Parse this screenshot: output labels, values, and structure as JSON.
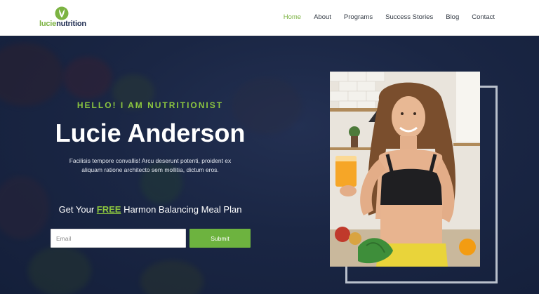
{
  "brand": {
    "name_part1": "lucie",
    "name_part2": "nutrition",
    "accent": "#7cb342",
    "navy": "#1d2b4f"
  },
  "nav": {
    "items": [
      {
        "label": "Home",
        "active": true
      },
      {
        "label": "About"
      },
      {
        "label": "Programs"
      },
      {
        "label": "Success Stories"
      },
      {
        "label": "Blog"
      },
      {
        "label": "Contact"
      }
    ]
  },
  "hero": {
    "kicker": "HELLO! I AM NUTRITIONIST",
    "name": "Lucie Anderson",
    "description": "Facilisis tempore convallis! Arcu deserunt potenti, proident ex aliquam ratione architecto sem mollitia, dictum eros.",
    "offer_prefix": "Get Your ",
    "offer_free": "FREE",
    "offer_suffix": " Harmon Balancing Meal Plan",
    "email_placeholder": "Email",
    "submit_label": "Submit"
  }
}
